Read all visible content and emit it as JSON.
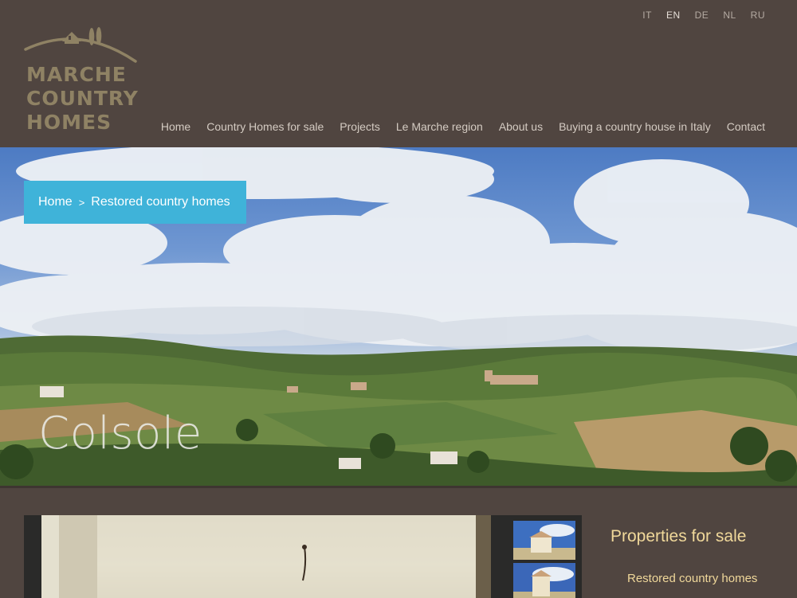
{
  "languages": [
    {
      "code": "IT",
      "active": false
    },
    {
      "code": "EN",
      "active": true
    },
    {
      "code": "DE",
      "active": false
    },
    {
      "code": "NL",
      "active": false
    },
    {
      "code": "RU",
      "active": false
    }
  ],
  "logo": {
    "line1": "MARCHE",
    "line2": "COUNTRY",
    "line3": "HOMES",
    "color": "#8f8264"
  },
  "nav": [
    "Home",
    "Country Homes for sale",
    "Projects",
    "Le Marche region",
    "About us",
    "Buying a country house in Italy",
    "Contact"
  ],
  "breadcrumb": {
    "home": "Home",
    "separator": ">",
    "current": "Restored country homes"
  },
  "hero": {
    "title": "Colsole"
  },
  "sidebar": {
    "title": "Properties for sale",
    "link": "Restored country homes"
  },
  "colors": {
    "background": "#504540",
    "breadcrumb": "#3fb3d9",
    "accent_text": "#f0d89a"
  }
}
